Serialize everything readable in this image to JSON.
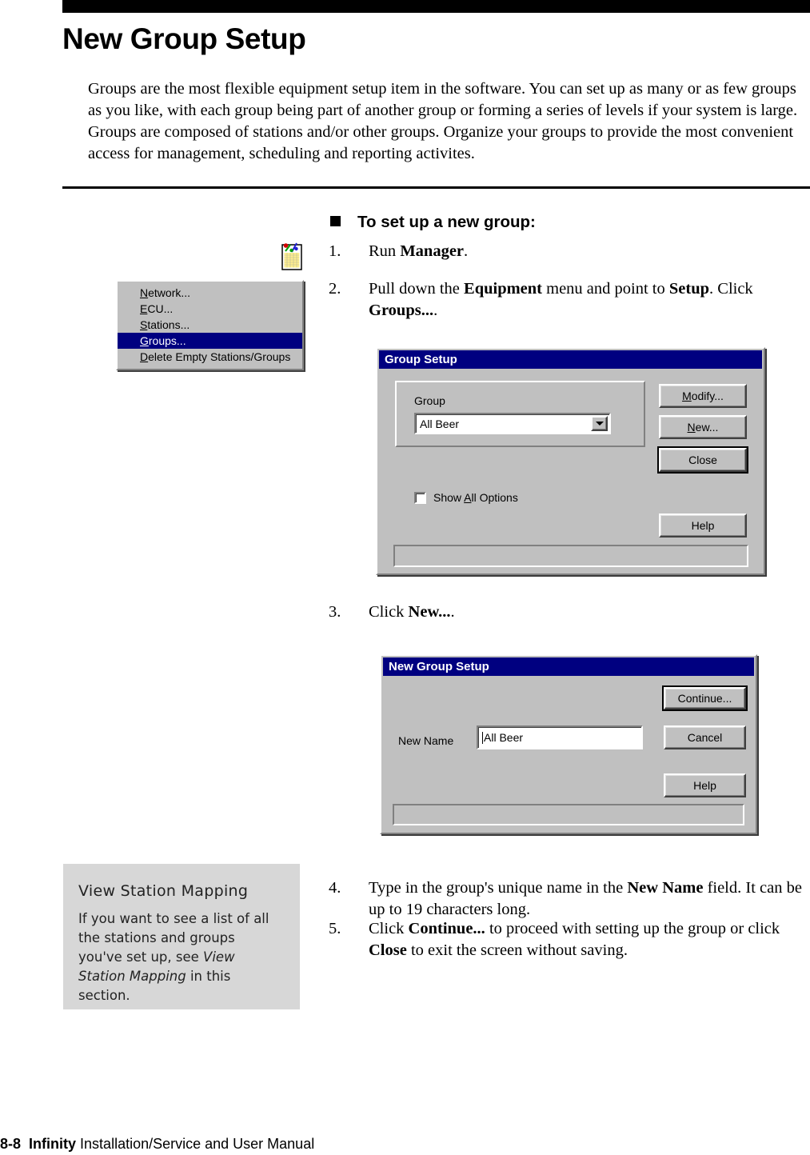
{
  "page": {
    "title": "New Group Setup",
    "intro": "Groups are the most flexible equipment setup item in the software. You can set up as many or as few groups as you like, with each group being part of another group or forming a series of levels if your system is large. Groups are composed of stations and/or other groups. Organize your groups to provide the most convenient access for management, scheduling and reporting activites.",
    "footer_page": "8-8",
    "footer_brand": "Infinity",
    "footer_title": "Installation/Service and User Manual"
  },
  "procedure": {
    "heading": "To set up a new group:",
    "steps": [
      {
        "num": "1.",
        "html": "Run <b>Manager</b>."
      },
      {
        "num": "2.",
        "html": "Pull down the <b>Equipment</b> menu and point to <b>Setup</b>. Click <b>Groups...</b>."
      },
      {
        "num": "3.",
        "html": "Click <b>New...</b>."
      },
      {
        "num": "4.",
        "html": "Type in the group's unique name in the <b>New Name</b> field. It can be up to 19 characters long."
      },
      {
        "num": "5.",
        "html": "Click <b>Continue...</b> to proceed with setting up the group or click <b>Close</b> to exit the screen without saving."
      }
    ]
  },
  "menu": {
    "items": [
      {
        "html": "<u>N</u>etwork...",
        "selected": false
      },
      {
        "html": "<u>E</u>CU...",
        "selected": false
      },
      {
        "html": "<u>S</u>tations...",
        "selected": false
      },
      {
        "html": "<u>G</u>roups...",
        "selected": true
      },
      {
        "html": "<u>D</u>elete Empty Stations/Groups",
        "selected": false
      }
    ],
    "highlight_color": "#000080"
  },
  "group_setup_dialog": {
    "title": "Group Setup",
    "group_label": "Group",
    "group_value": "All Beer",
    "checkbox_label_html": "Show <u>A</u>ll Options",
    "checkbox_checked": false,
    "buttons": [
      {
        "html": "<u>M</u>odify...",
        "default": false
      },
      {
        "html": "<u>N</u>ew...",
        "default": false
      },
      {
        "html": "Close",
        "default": true
      },
      {
        "html": "Help",
        "default": false
      }
    ],
    "status_text": ""
  },
  "new_group_dialog": {
    "title": "New Group Setup",
    "name_label": "New Name",
    "name_value": "All Beer",
    "buttons": [
      {
        "html": "Continue...",
        "default": true
      },
      {
        "html": "Cancel",
        "default": false
      },
      {
        "html": "Help",
        "default": false
      }
    ],
    "status_text": ""
  },
  "note": {
    "title": "View Station Mapping",
    "body_html": "If you want to see a list of all the stations and groups you've set up, see <i>View Station Mapping</i> in this section."
  },
  "icons": {
    "notepad": "notepad-pencils-icon",
    "bullet": "square-bullet-icon",
    "combo": "chevron-down-icon"
  },
  "colors": {
    "titlebar": "#000080",
    "dialog_face": "#c0c0c0",
    "note_bg": "#d7d7d7"
  }
}
